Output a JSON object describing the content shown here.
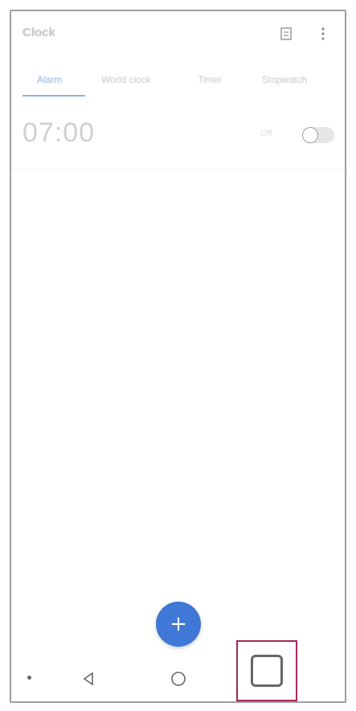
{
  "app": {
    "title": "Clock"
  },
  "tabs": [
    {
      "label": "Alarm"
    },
    {
      "label": "World clock"
    },
    {
      "label": "Timer"
    },
    {
      "label": "Stopwatch"
    }
  ],
  "alarm": {
    "time": "07:00",
    "status": "Off"
  },
  "fab": {
    "label": "+"
  },
  "colors": {
    "accent": "#3f78d6",
    "highlight": "#a3295a"
  }
}
